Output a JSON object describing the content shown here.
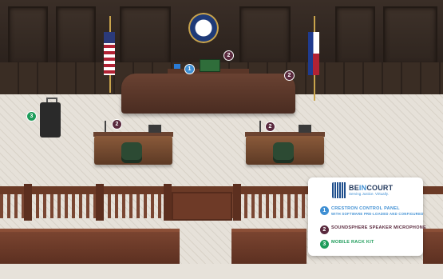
{
  "scene": {
    "markers": [
      {
        "id": "marker-1",
        "number": "1",
        "kind": "crestron"
      },
      {
        "id": "marker-2",
        "number": "2",
        "kind": "microphone"
      },
      {
        "id": "marker-3",
        "number": "3",
        "kind": "rack"
      }
    ]
  },
  "legend": {
    "logo": {
      "brand_be": "BE",
      "brand_in": "IN",
      "brand_court": "COURT",
      "tagline": "Serving Justice. Virtually."
    },
    "items": [
      {
        "number": "1",
        "title": "CRESTRON CONTROL PANEL",
        "subtitle": "WITH SOFTWARE PRE-LOADED AND CONFIGURED",
        "color": "#3f8fd3"
      },
      {
        "number": "2",
        "title": "SOUNDSPHERE SPEAKER MICROPHONE",
        "subtitle": "",
        "color": "#5a2a3e"
      },
      {
        "number": "3",
        "title": "MOBILE RACK KIT",
        "subtitle": "",
        "color": "#1e9c5a"
      }
    ]
  },
  "colors": {
    "accent_blue": "#3f8fd3",
    "accent_maroon": "#5a2a3e",
    "accent_green": "#1e9c5a"
  }
}
